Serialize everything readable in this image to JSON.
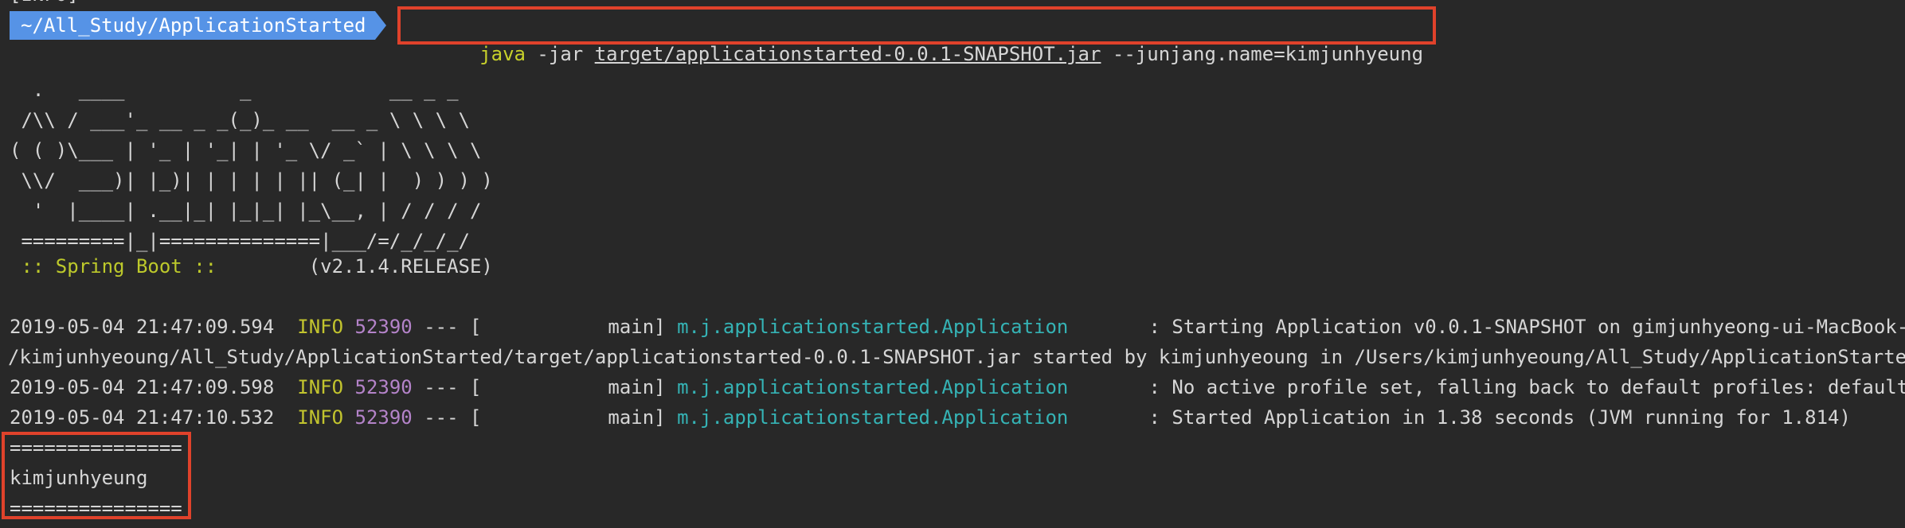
{
  "prompt": {
    "path": "~/All_Study/ApplicationStarted",
    "command_bin": "java",
    "command_flag": " -jar ",
    "command_jar": "target/applicationstarted-0.0.1-SNAPSHOT.jar",
    "command_arg": " --junjang.name=kimjunhyeung"
  },
  "top_partial": "[INFO]",
  "banner": [
    "  .   ____          _            __ _ _",
    " /\\\\ / ___'_ __ _ _(_)_ __  __ _ \\ \\ \\ \\",
    "( ( )\\___ | '_ | '_| | '_ \\/ _` | \\ \\ \\ \\",
    " \\\\/  ___)| |_)| | | | | || (_| |  ) ) ) )",
    "  '  |____| .__|_| |_|_| |_\\__, | / / / /",
    " =========|_|==============|___/=/_/_/_/"
  ],
  "spring_label": " :: Spring Boot :: ",
  "spring_version": "       (v2.1.4.RELEASE)",
  "logs": [
    {
      "timestamp": "2019-05-04 21:47:09.594",
      "level": "INFO",
      "pid": "52390",
      "sep": " --- [           main] ",
      "logger": "m.j.applicationstarted.Application",
      "message": "       : Starting Application v0.0.1-SNAPSHOT on gimjunhyeong-ui-MacBook-Pro.l"
    },
    {
      "continuation": "/kimjunhyeoung/All_Study/ApplicationStarted/target/applicationstarted-0.0.1-SNAPSHOT.jar started by kimjunhyeoung in /Users/kimjunhyeoung/All_Study/ApplicationStarted)"
    },
    {
      "timestamp": "2019-05-04 21:47:09.598",
      "level": "INFO",
      "pid": "52390",
      "sep": " --- [           main] ",
      "logger": "m.j.applicationstarted.Application",
      "message": "       : No active profile set, falling back to default profiles: default"
    },
    {
      "timestamp": "2019-05-04 21:47:10.532",
      "level": "INFO",
      "pid": "52390",
      "sep": " --- [           main] ",
      "logger": "m.j.applicationstarted.Application",
      "message": "       : Started Application in 1.38 seconds (JVM running for 1.814)"
    }
  ],
  "output": {
    "rule_top": "===============",
    "name": "kimjunhyeung",
    "rule_bottom": "==============="
  },
  "colors": {
    "background": "#282828",
    "prompt_bg": "#5693e6",
    "highlight_box": "#e0422b",
    "command_bin": "#c8d12b",
    "level_info": "#c2c42e",
    "pid": "#b483c9",
    "logger": "#35b3b5"
  }
}
